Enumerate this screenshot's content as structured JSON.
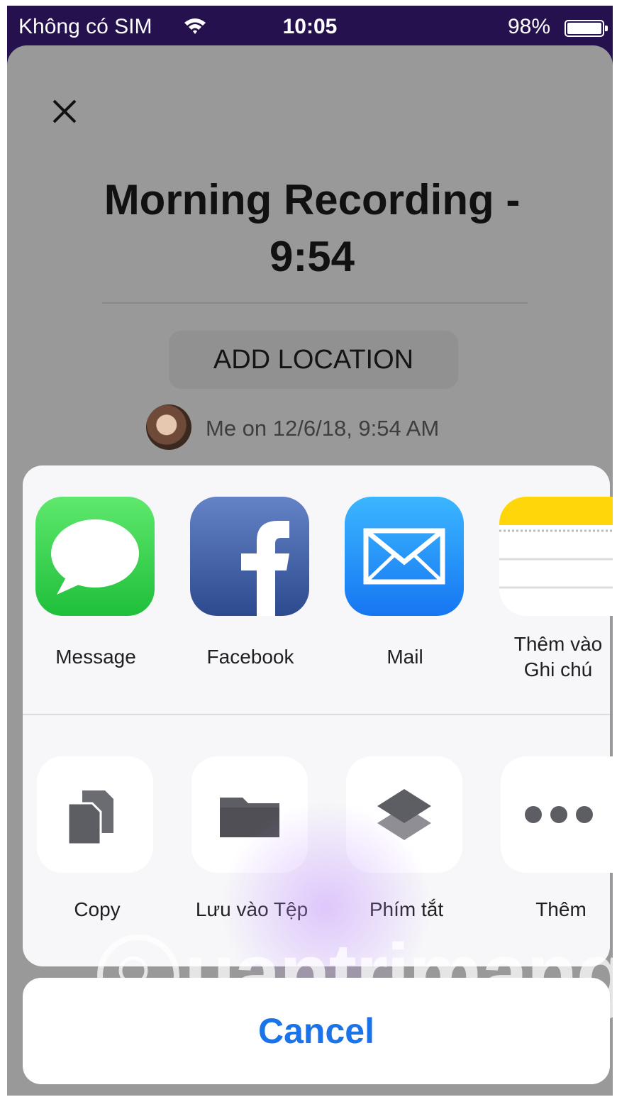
{
  "status_bar": {
    "carrier": "Không có SIM",
    "time": "10:05",
    "battery": "98%"
  },
  "recording": {
    "title": "Morning Recording - 9:54",
    "add_location_label": "ADD LOCATION",
    "meta": "Me on 12/6/18, 9:54 AM"
  },
  "share_apps": [
    {
      "label": "Message",
      "icon": "messages-icon",
      "color": "#2ecc40"
    },
    {
      "label": "Facebook",
      "icon": "facebook-icon",
      "color": "#3b5998"
    },
    {
      "label": "Mail",
      "icon": "mail-icon",
      "color": "#1e90ff"
    },
    {
      "label": "Thêm vào\nGhi chú",
      "icon": "notes-icon",
      "color": "#ffd60a"
    }
  ],
  "share_actions": [
    {
      "label": "Copy",
      "icon": "copy-icon"
    },
    {
      "label": "Lưu vào Tệp",
      "icon": "folder-icon"
    },
    {
      "label": "Phím tắt",
      "icon": "shortcuts-icon"
    },
    {
      "label": "Thêm",
      "icon": "more-icon"
    }
  ],
  "cancel_label": "Cancel",
  "watermark": "uantrimang",
  "colors": {
    "status_bar_bg": "#25114e",
    "dimmed_sheet": "#999999",
    "action_blue": "#1a73e8"
  }
}
